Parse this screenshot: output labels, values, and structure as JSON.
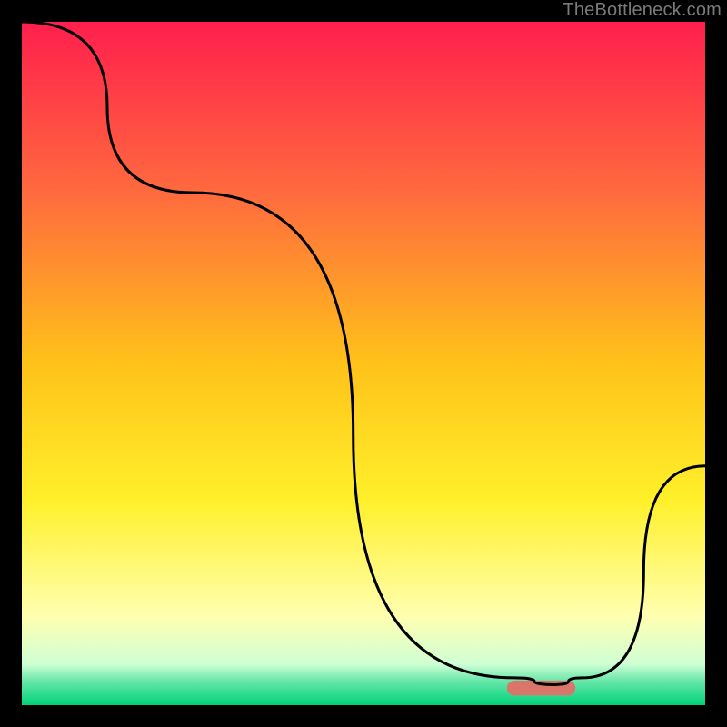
{
  "watermark": {
    "text": "TheBottleneck.com"
  },
  "chart_data": {
    "type": "line",
    "title": "",
    "xlabel": "",
    "ylabel": "",
    "xlim": [
      0,
      100
    ],
    "ylim": [
      0,
      100
    ],
    "grid": false,
    "series": [
      {
        "name": "curve",
        "x": [
          0,
          25,
          72,
          78,
          82,
          100
        ],
        "y": [
          100,
          75,
          4,
          3,
          4,
          35
        ]
      }
    ],
    "marker": {
      "shape": "rounded-bar",
      "x_center": 76,
      "y_center": 2.5,
      "width": 10,
      "height": 2.2,
      "color": "#d9756b"
    },
    "background_gradient": {
      "type": "vertical",
      "stops": [
        {
          "pos": 0.0,
          "color": "#ff1f4d"
        },
        {
          "pos": 0.25,
          "color": "#ff6a3e"
        },
        {
          "pos": 0.5,
          "color": "#ffc21a"
        },
        {
          "pos": 0.7,
          "color": "#fff02a"
        },
        {
          "pos": 0.87,
          "color": "#ffffb0"
        },
        {
          "pos": 0.94,
          "color": "#cfffd4"
        },
        {
          "pos": 0.965,
          "color": "#66e6a8"
        },
        {
          "pos": 1.0,
          "color": "#00d37a"
        }
      ]
    }
  }
}
